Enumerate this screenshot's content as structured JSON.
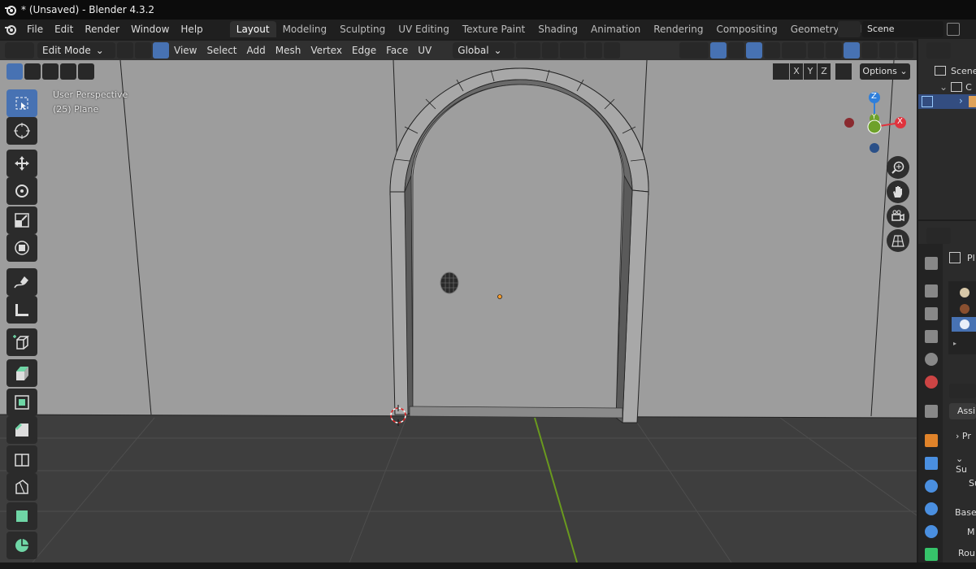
{
  "window": {
    "title": "* (Unsaved) - Blender 4.3.2"
  },
  "menu": {
    "items": [
      "File",
      "Edit",
      "Render",
      "Window",
      "Help"
    ]
  },
  "workspaces": {
    "active": "Layout",
    "tabs": [
      "Layout",
      "Modeling",
      "Sculpting",
      "UV Editing",
      "Texture Paint",
      "Shading",
      "Animation",
      "Rendering",
      "Compositing",
      "Geometry Node"
    ]
  },
  "scene": {
    "name": "Scene"
  },
  "header": {
    "mode": "Edit Mode",
    "menus": [
      "View",
      "Select",
      "Add",
      "Mesh",
      "Vertex",
      "Edge",
      "Face",
      "UV"
    ],
    "orientation": "Global",
    "options_label": "Options",
    "axes": [
      "X",
      "Y",
      "Z"
    ]
  },
  "viewport": {
    "perspective": "User Perspective",
    "object": "(25) Plane",
    "bg_color": "#3d3d3d",
    "wall_color": "#9d9d9d",
    "floor_color": "#3e3e3e"
  },
  "gizmo": {
    "x": "X",
    "y": "Y",
    "z": "Z",
    "x_color": "#e0333d",
    "y_color": "#6ea12a",
    "z_color": "#2f7fdb"
  },
  "outliner": {
    "row1": "Scene",
    "row2": "C"
  },
  "properties": {
    "obj_label": "Pl",
    "assign_label": "Assi",
    "rows": [
      "Pr",
      "Su",
      "Su",
      "Base",
      "M",
      "Rou"
    ]
  },
  "accent": "#4772b3"
}
